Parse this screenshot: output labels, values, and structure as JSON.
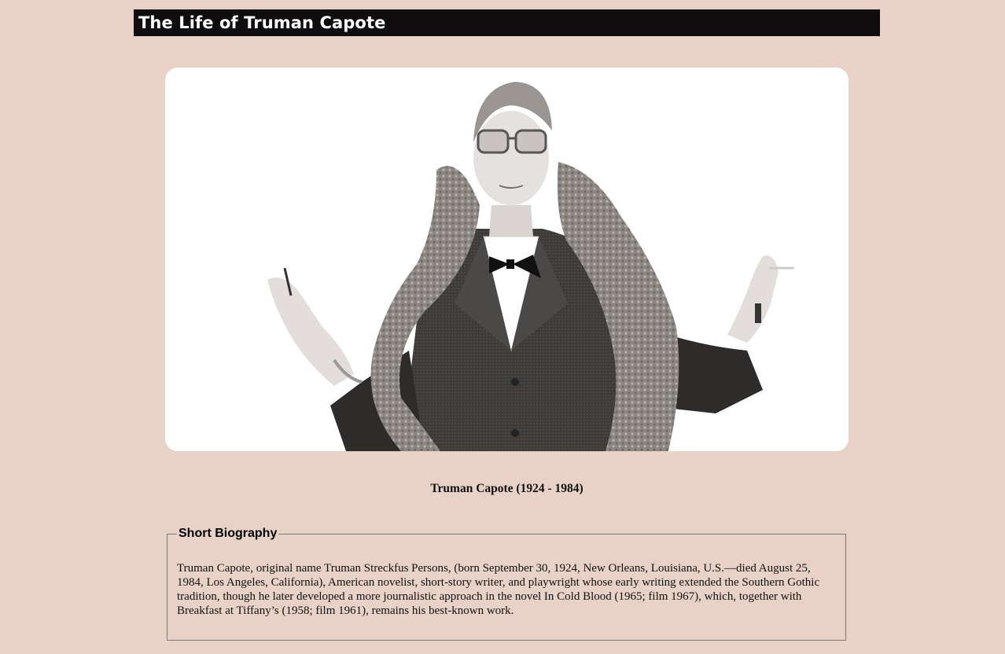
{
  "header": {
    "title": "The Life of Truman Capote"
  },
  "photo": {
    "icon": "portrait-photo",
    "subject": "Truman Capote portrait"
  },
  "caption": "Truman Capote (1924 - 1984)",
  "biography": {
    "legend": "Short Biography",
    "text": "Truman Capote, original name Truman Streckfus Persons, (born September 30, 1924, New Orleans, Louisiana, U.S.—died August 25, 1984, Los Angeles, California), American novelist, short-story writer, and playwright whose early writing extended the Southern Gothic tradition, though he later developed a more journalistic approach in the novel In Cold Blood (1965; film 1967), which, together with Breakfast at Tiffany’s (1958; film 1961), remains his best-known work."
  },
  "colors": {
    "page_background": "#e8d2c7",
    "title_bar": "#0f0d0d",
    "title_text": "#ffffff",
    "card_background": "#ffffff",
    "fieldset_border": "#7b7b7b"
  }
}
